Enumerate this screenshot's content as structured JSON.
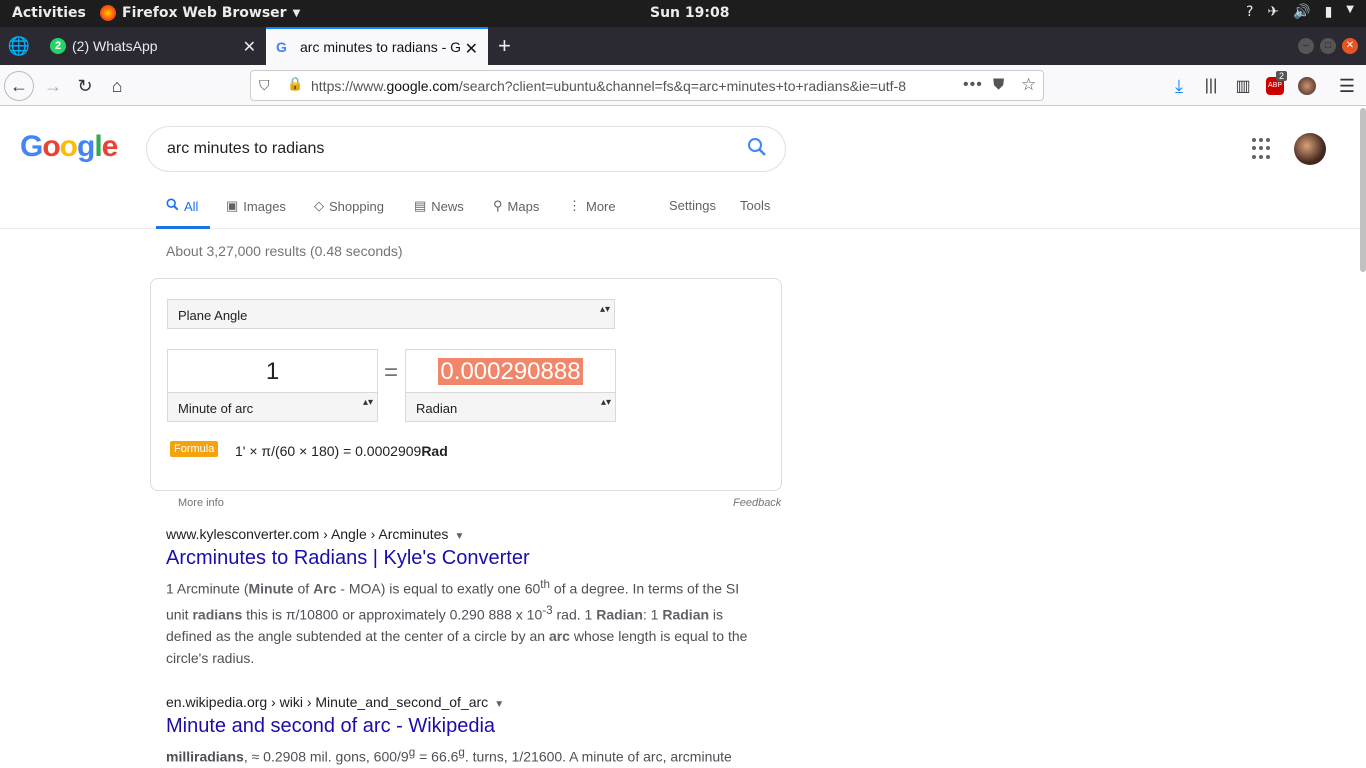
{
  "topbar": {
    "activities": "Activities",
    "app_name": "Firefox Web Browser",
    "clock": "Sun 19:08"
  },
  "tabs": [
    {
      "label": "(2) WhatsApp",
      "badge": "2"
    },
    {
      "label": "arc minutes to radians - G"
    }
  ],
  "urlbar": {
    "url_prefix": "https://www.",
    "url_domain": "google.com",
    "url_rest": "/search?client=ubuntu&channel=fs&q=arc+minutes+to+radians&ie=utf-8"
  },
  "toolbar": {
    "adblock_count": "2"
  },
  "google": {
    "query": "arc minutes to radians",
    "tabs": [
      "All",
      "Images",
      "Shopping",
      "News",
      "Maps",
      "More"
    ],
    "settings": "Settings",
    "tools": "Tools",
    "stats": "About 3,27,000 results (0.48 seconds)"
  },
  "converter": {
    "category": "Plane Angle",
    "from_value": "1",
    "from_unit": "Minute of arc",
    "equals": "=",
    "to_value": "0.000290888",
    "to_unit": "Radian",
    "formula_label": "Formula",
    "formula_text": "1' × π/(60 × 180) = 0.0002909",
    "formula_unit": "Rad",
    "more_info": "More info",
    "feedback": "Feedback"
  },
  "results": [
    {
      "cite": "www.kylesconverter.com › Angle › Arcminutes",
      "title": "Arcminutes to Radians | Kyle's Converter"
    },
    {
      "cite": "en.wikipedia.org › wiki › Minute_and_second_of_arc",
      "title": "Minute and second of arc - Wikipedia"
    }
  ]
}
